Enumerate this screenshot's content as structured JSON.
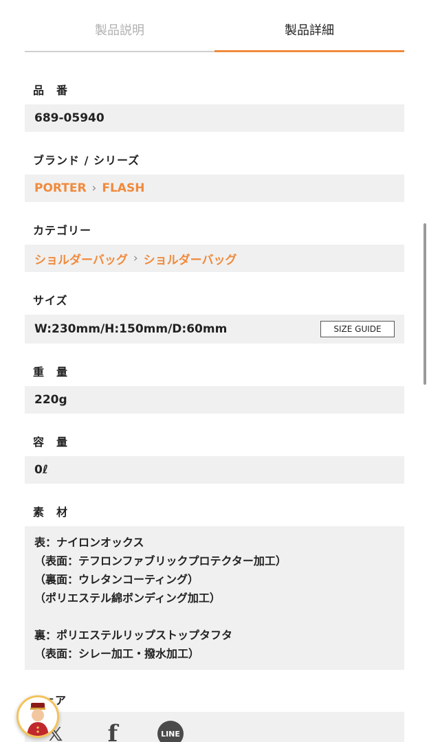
{
  "tabs": [
    {
      "label": "製品説明",
      "active": false
    },
    {
      "label": "製品詳細",
      "active": true
    }
  ],
  "details": {
    "part_number": {
      "label": "品　番",
      "value": "689-05940"
    },
    "brand": {
      "label": "ブランド / シリーズ",
      "brand": "PORTER",
      "separator": "›",
      "series": "FLASH"
    },
    "category": {
      "label": "カテゴリー",
      "parent": "ショルダーバッグ",
      "separator": "›",
      "child": "ショルダーバッグ"
    },
    "size": {
      "label": "サイズ",
      "value": "W:230mm/H:150mm/D:60mm",
      "guide_button": "SIZE GUIDE"
    },
    "weight": {
      "label": "重　量",
      "value": "220g"
    },
    "capacity": {
      "label": "容　量",
      "value": "0ℓ"
    },
    "material": {
      "label": "素　材",
      "lines": [
        "表：ナイロンオックス",
        "（表面：テフロンファブリックプロテクター加工）",
        "（裏面：ウレタンコーティング）",
        "（ポリエステル綿ボンディング加工）",
        "",
        "裏：ポリエステルリップストップタフタ",
        "（表面：シレー加工・撥水加工）"
      ]
    }
  },
  "share": {
    "label": "シェア",
    "icons": [
      "x-icon",
      "facebook-icon",
      "line-icon"
    ],
    "line_text": "LINE",
    "facebook_glyph": "f",
    "x_glyph": "𝕏"
  },
  "colors": {
    "accent": "#f08a3c",
    "box_bg": "#f0f0f0"
  }
}
